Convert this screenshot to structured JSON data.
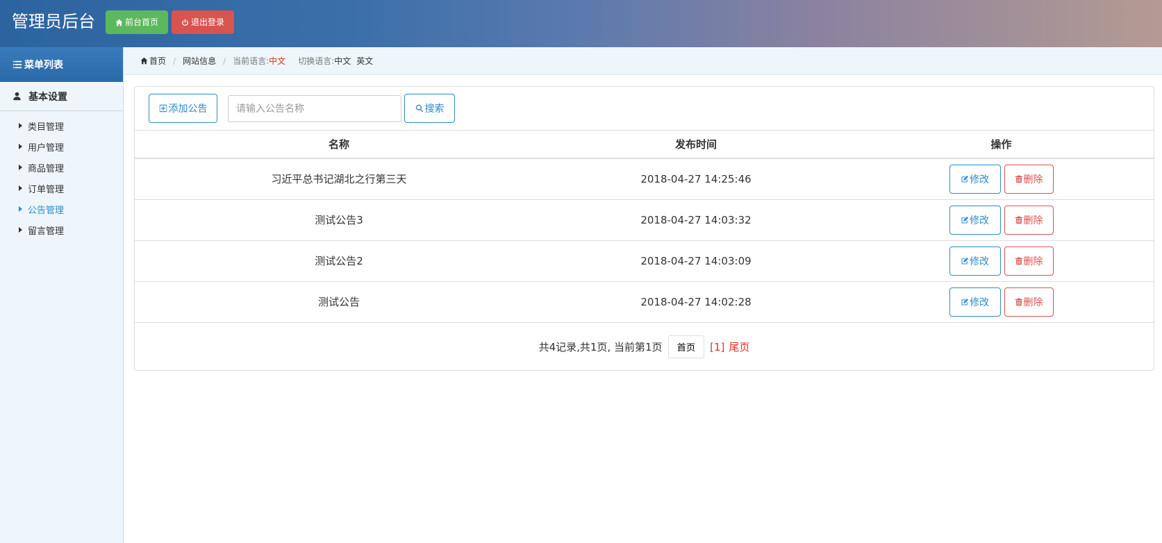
{
  "header": {
    "title": "管理员后台",
    "home_button": "前台首页",
    "logout_button": "退出登录",
    "colors": {
      "home": "#5cb85c",
      "logout": "#d9534f"
    }
  },
  "sidebar": {
    "title": "菜单列表",
    "group": "基本设置",
    "items": [
      {
        "label": "类目管理",
        "active": false
      },
      {
        "label": "用户管理",
        "active": false
      },
      {
        "label": "商品管理",
        "active": false
      },
      {
        "label": "订单管理",
        "active": false
      },
      {
        "label": "公告管理",
        "active": true
      },
      {
        "label": "留言管理",
        "active": false
      }
    ]
  },
  "breadcrumb": {
    "home": "首页",
    "site_info": "网站信息",
    "current_lang_label": "当前语言:",
    "current_lang": "中文",
    "switch_label": "切换语言:",
    "lang_zh": "中文",
    "lang_en": "英文"
  },
  "toolbar": {
    "add_button": "添加公告",
    "search_placeholder": "请输入公告名称",
    "search_value": "",
    "search_button": "搜索"
  },
  "table": {
    "headers": [
      "名称",
      "发布时间",
      "操作"
    ],
    "rows": [
      {
        "name": "习近平总书记湖北之行第三天",
        "time": "2018-04-27 14:25:46"
      },
      {
        "name": "测试公告3",
        "time": "2018-04-27 14:03:32"
      },
      {
        "name": "测试公告2",
        "time": "2018-04-27 14:03:09"
      },
      {
        "name": "测试公告",
        "time": "2018-04-27 14:02:28"
      }
    ],
    "edit_label": "修改",
    "delete_label": "删除"
  },
  "pagination": {
    "summary": "共4记录,共1页, 当前第1页",
    "first": "首页",
    "page": "[1]",
    "last": "尾页"
  }
}
